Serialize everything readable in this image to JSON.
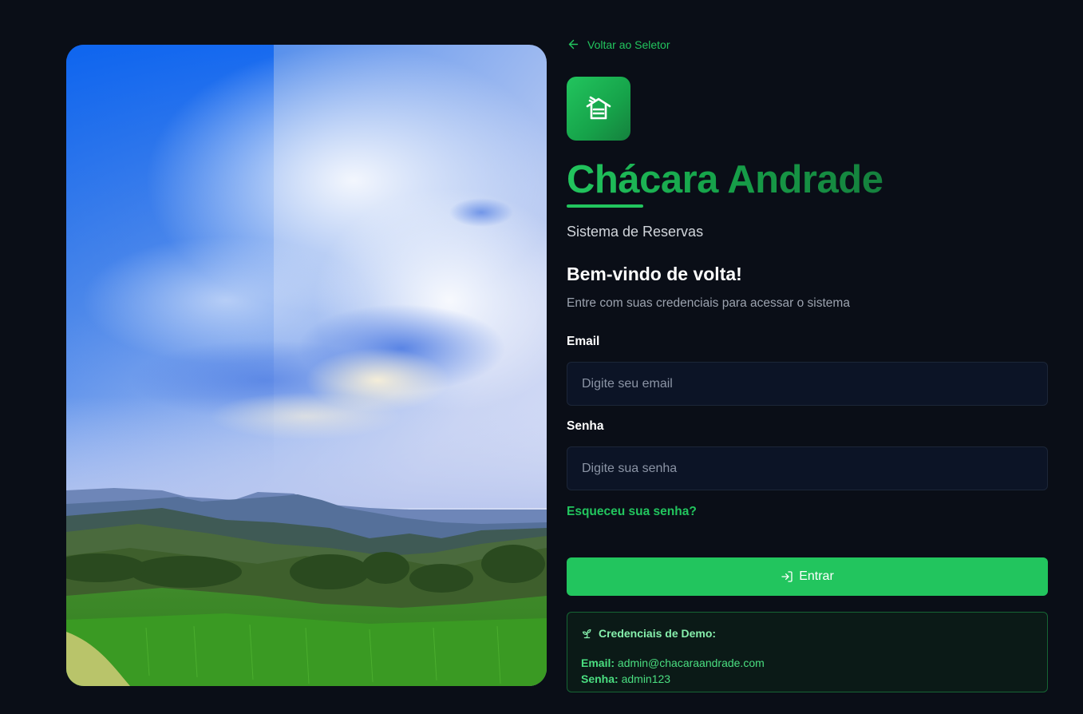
{
  "nav": {
    "back_label": "Voltar ao Seletor"
  },
  "brand": {
    "title": "Chácara Andrade",
    "subtitle": "Sistema de Reservas",
    "accent_color": "#22c55e"
  },
  "login": {
    "heading": "Bem-vindo de volta!",
    "description": "Entre com suas credenciais para acessar o sistema",
    "email": {
      "label": "Email",
      "placeholder": "Digite seu email",
      "value": ""
    },
    "password": {
      "label": "Senha",
      "placeholder": "Digite sua senha",
      "value": ""
    },
    "forgot_label": "Esqueceu sua senha?",
    "submit_label": "Entrar"
  },
  "demo": {
    "heading": "Credenciais de Demo:",
    "email_key": "Email:",
    "email_value": "admin@chacaraandrade.com",
    "password_key": "Senha:",
    "password_value": "admin123"
  },
  "icons": {
    "back": "arrow-left-icon",
    "logo": "house-icon",
    "submit": "log-in-icon",
    "demo": "sprout-icon"
  }
}
